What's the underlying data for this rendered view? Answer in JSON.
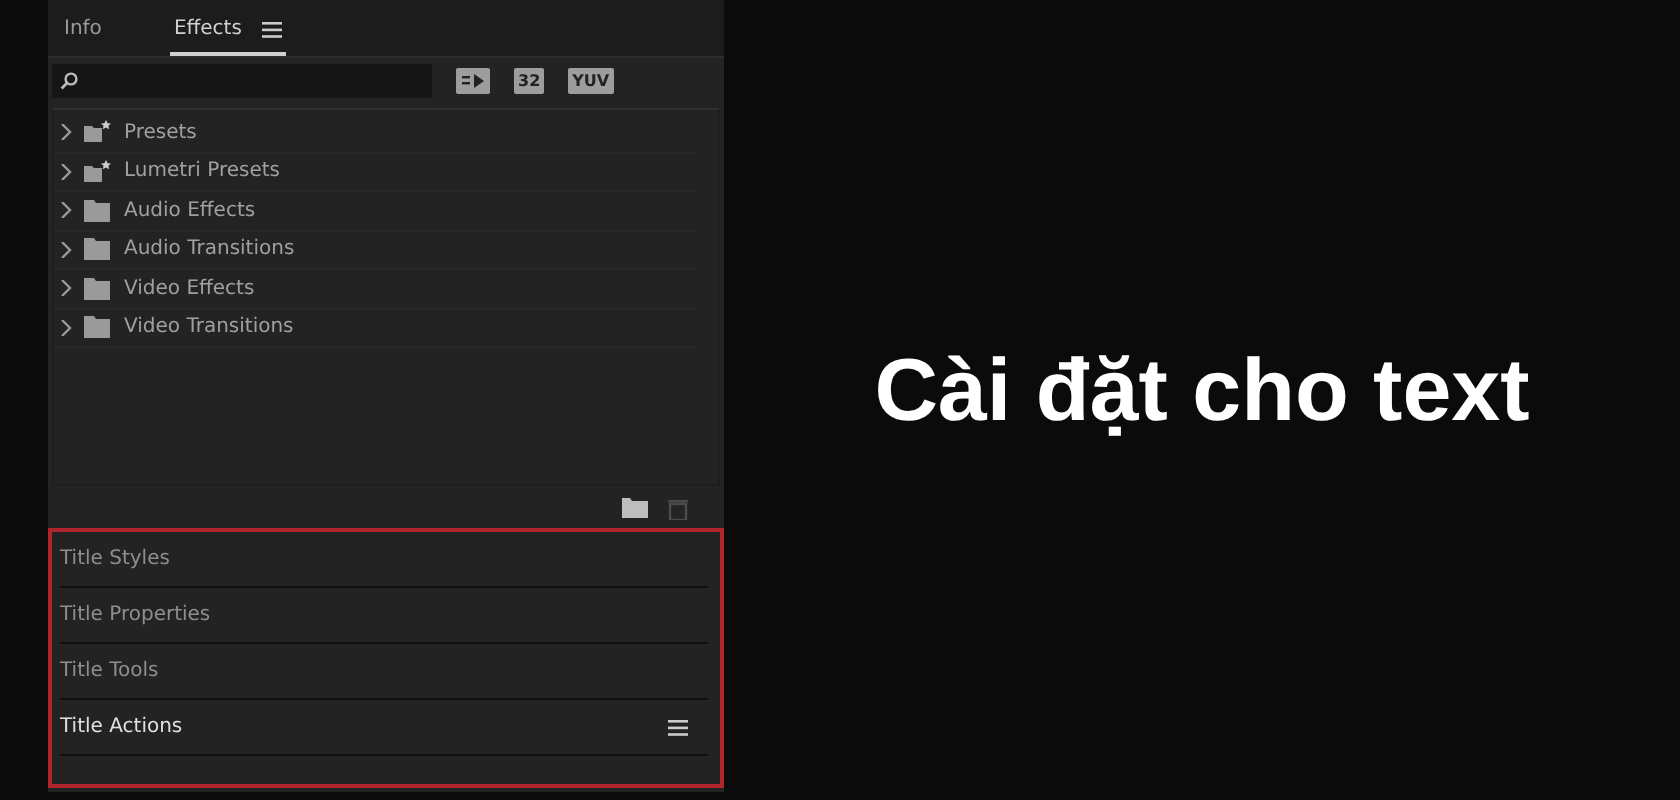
{
  "tabs": [
    {
      "label": "Info",
      "selected": false
    },
    {
      "label": "Effects",
      "selected": true
    }
  ],
  "toolbar_buttons": [
    {
      "kind": "accelerated"
    },
    {
      "kind": "label",
      "label": "32"
    },
    {
      "kind": "label",
      "label": "YUV"
    }
  ],
  "tree": [
    {
      "label": "Presets",
      "kind": "preset_folder",
      "expanded": false
    },
    {
      "label": "Lumetri Presets",
      "kind": "preset_folder",
      "expanded": false
    },
    {
      "label": "Audio Effects",
      "kind": "folder",
      "expanded": false
    },
    {
      "label": "Audio Transitions",
      "kind": "folder",
      "expanded": false
    },
    {
      "label": "Video Effects",
      "kind": "folder",
      "expanded": false
    },
    {
      "label": "Video Transitions",
      "kind": "folder",
      "expanded": false
    }
  ],
  "title_panels": [
    {
      "label": "Title Styles",
      "active": false
    },
    {
      "label": "Title Properties",
      "active": false
    },
    {
      "label": "Title Tools",
      "active": false
    },
    {
      "label": "Title Actions",
      "active": true
    }
  ],
  "caption": "Cài đặt cho text"
}
